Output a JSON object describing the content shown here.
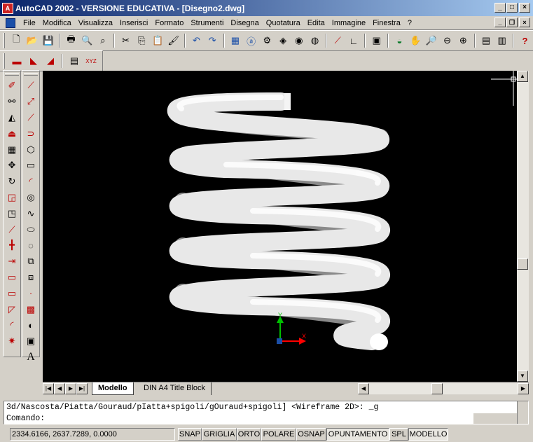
{
  "window": {
    "title": "AutoCAD 2002 - VERSIONE EDUCATIVA - [Disegno2.dwg]"
  },
  "menu": [
    "File",
    "Modifica",
    "Visualizza",
    "Inserisci",
    "Formato",
    "Strumenti",
    "Disegna",
    "Quotatura",
    "Edita",
    "Immagine",
    "Finestra",
    "?"
  ],
  "toolbar1_icons": [
    "new-icon",
    "open-icon",
    "save-icon",
    "print-icon",
    "print-preview-icon",
    "find-icon",
    "cut-icon",
    "copy-icon",
    "paste-icon",
    "match-properties-icon",
    "undo-icon",
    "redo-icon",
    "design-center-icon",
    "browse-web-icon",
    "properties-icon",
    "tool-palette-icon",
    "pan-icon",
    "zoom-realtime-icon",
    "zoom-window-icon",
    "zoom-previous-icon",
    "distance-icon",
    "ucs-icon",
    "named-views-icon",
    "orbit-icon",
    "dbconnect-icon",
    "help-icon"
  ],
  "toolbar2_icons": [
    "layer-manager-icon",
    "layer-previous-icon",
    "object-layer-icon",
    "text-style-icon",
    "ucs-xyz-icon"
  ],
  "draw_tools": [
    "line-icon",
    "construction-line-icon",
    "polyline-icon",
    "polygon-icon",
    "rectangle-icon",
    "arc-icon",
    "circle-icon",
    "revision-cloud-icon",
    "spline-icon",
    "ellipse-icon",
    "ellipse-arc-icon",
    "insert-block-icon",
    "make-block-icon",
    "point-icon",
    "hatch-icon",
    "region-icon",
    "table-icon",
    "text-icon"
  ],
  "modify_tools": [
    "erase-icon",
    "copy-object-icon",
    "mirror-icon",
    "offset-icon",
    "array-icon",
    "move-icon",
    "rotate-icon",
    "scale-icon",
    "stretch-icon",
    "trim-icon",
    "extend-icon",
    "break-icon",
    "join-icon",
    "chamfer-icon",
    "fillet-icon",
    "explode-icon"
  ],
  "layout_tabs": {
    "model": "Modello",
    "layout1": "DIN A4 Title Block"
  },
  "command": {
    "history": "3d/Nascosta/Piatta/Gouraud/pIatta+spigoli/gOuraud+spigoli] <Wireframe 2D>: _g",
    "prompt": "Comando:"
  },
  "status": {
    "coords": "2334.6166, 2637.7289, 0.0000",
    "buttons": [
      "SNAP",
      "GRIGLIA",
      "ORTO",
      "POLARE",
      "OSNAP",
      "OPUNTAMENTO",
      "SPL",
      "MODELLO"
    ]
  },
  "ucs": {
    "x": "X",
    "y": "Y"
  },
  "colors": {
    "title_start": "#0a246a",
    "title_end": "#a6caf0",
    "viewport_bg": "#000000",
    "ucs_x": "#ff0000",
    "ucs_y": "#00c000"
  }
}
